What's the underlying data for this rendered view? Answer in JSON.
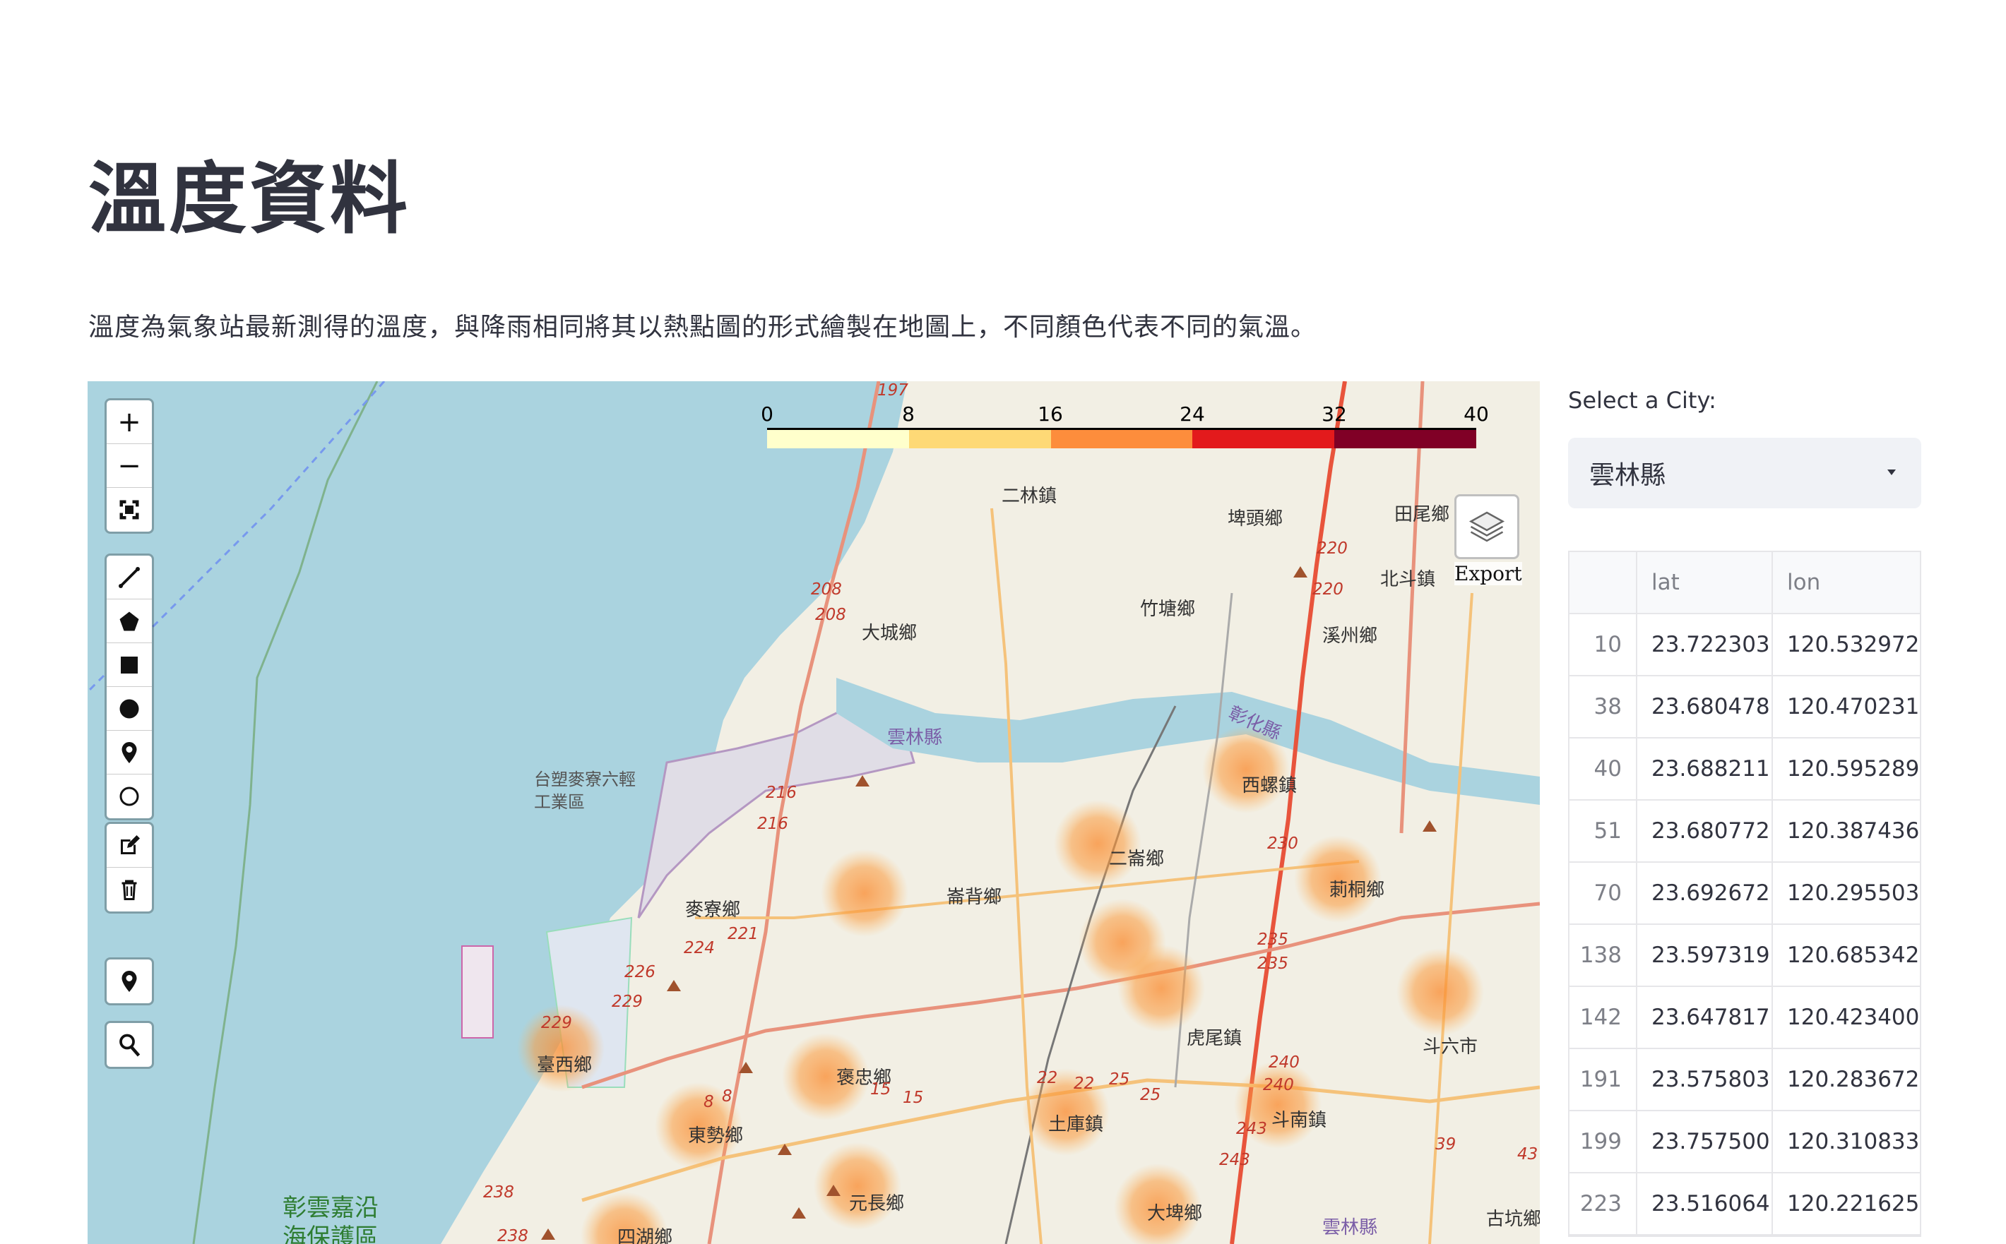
{
  "page": {
    "title": "溫度資料",
    "description": "溫度為氣象站最新測得的溫度，與降雨相同將其以熱點圖的形式繪製在地圖上，不同顏色代表不同的氣溫。"
  },
  "map": {
    "legend": {
      "ticks": [
        "0",
        "8",
        "16",
        "24",
        "32",
        "40"
      ],
      "colors": [
        "#ffffcc",
        "#fed976",
        "#fd8d3c",
        "#e31a1c",
        "#e31a1c",
        "#800026"
      ]
    },
    "export_label": "Export",
    "toolbar_icons": [
      "plus-icon",
      "minus-icon",
      "fullscreen-icon",
      "polyline-icon",
      "polygon-icon",
      "rectangle-icon",
      "circle-icon",
      "marker-icon",
      "circle-marker-icon",
      "edit-icon",
      "trash-icon",
      "locate-icon",
      "search-icon"
    ],
    "place_labels": [
      {
        "id": "erlin",
        "text": "二林鎮"
      },
      {
        "id": "pitou",
        "text": "埤頭鄉"
      },
      {
        "id": "tianwei",
        "text": "田尾鄉"
      },
      {
        "id": "beidou",
        "text": "北斗鎮"
      },
      {
        "id": "zhutang",
        "text": "竹塘鄉"
      },
      {
        "id": "xizhou",
        "text": "溪州鄉"
      },
      {
        "id": "dacheng",
        "text": "大城鄉"
      },
      {
        "id": "yunlin",
        "text": "雲林縣"
      },
      {
        "id": "xiluo",
        "text": "西螺鎮"
      },
      {
        "id": "erlun",
        "text": "二崙鄉"
      },
      {
        "id": "citong",
        "text": "莿桐鄉"
      },
      {
        "id": "lunbei",
        "text": "崙背鄉"
      },
      {
        "id": "mailiao",
        "text": "麥寮鄉"
      },
      {
        "id": "huwei",
        "text": "虎尾鎮"
      },
      {
        "id": "douliu",
        "text": "斗六市"
      },
      {
        "id": "taixi",
        "text": "臺西鄉"
      },
      {
        "id": "baozhong",
        "text": "褒忠鄉"
      },
      {
        "id": "tuku",
        "text": "土庫鎮"
      },
      {
        "id": "dounan",
        "text": "斗南鎮"
      },
      {
        "id": "dongshi",
        "text": "東勢鄉"
      },
      {
        "id": "yuanchang",
        "text": "元長鄉"
      },
      {
        "id": "dapi",
        "text": "大埤鄉"
      },
      {
        "id": "sihu",
        "text": "四湖鄉"
      },
      {
        "id": "gukeng",
        "text": "古坑鄉"
      },
      {
        "id": "yunlin2",
        "text": "雲林縣"
      },
      {
        "id": "plastic",
        "text": "台塑麥寮六輕工業區"
      },
      {
        "id": "reserve",
        "text": "彰雲嘉沿海保護區"
      },
      {
        "id": "changhua",
        "text": "彰化縣"
      }
    ],
    "route_labels": [
      "197",
      "208",
      "208",
      "216",
      "216",
      "221",
      "224",
      "226",
      "229",
      "229",
      "220",
      "220",
      "230",
      "235",
      "235",
      "240",
      "240",
      "243",
      "243",
      "22",
      "22",
      "25",
      "25",
      "15",
      "15",
      "8",
      "8",
      "39",
      "43",
      "238",
      "238"
    ]
  },
  "sidebar": {
    "select_label": "Select a City:",
    "selected_city": "雲林縣",
    "table": {
      "columns": [
        "",
        "lat",
        "lon"
      ],
      "rows": [
        [
          "10",
          "23.722303",
          "120.532972"
        ],
        [
          "38",
          "23.680478",
          "120.470231"
        ],
        [
          "40",
          "23.688211",
          "120.595289"
        ],
        [
          "51",
          "23.680772",
          "120.387436"
        ],
        [
          "70",
          "23.692672",
          "120.295503"
        ],
        [
          "138",
          "23.597319",
          "120.685342"
        ],
        [
          "142",
          "23.647817",
          "120.423400"
        ],
        [
          "191",
          "23.575803",
          "120.283672"
        ],
        [
          "199",
          "23.757500",
          "120.310833"
        ],
        [
          "223",
          "23.516064",
          "120.221625"
        ]
      ]
    }
  }
}
